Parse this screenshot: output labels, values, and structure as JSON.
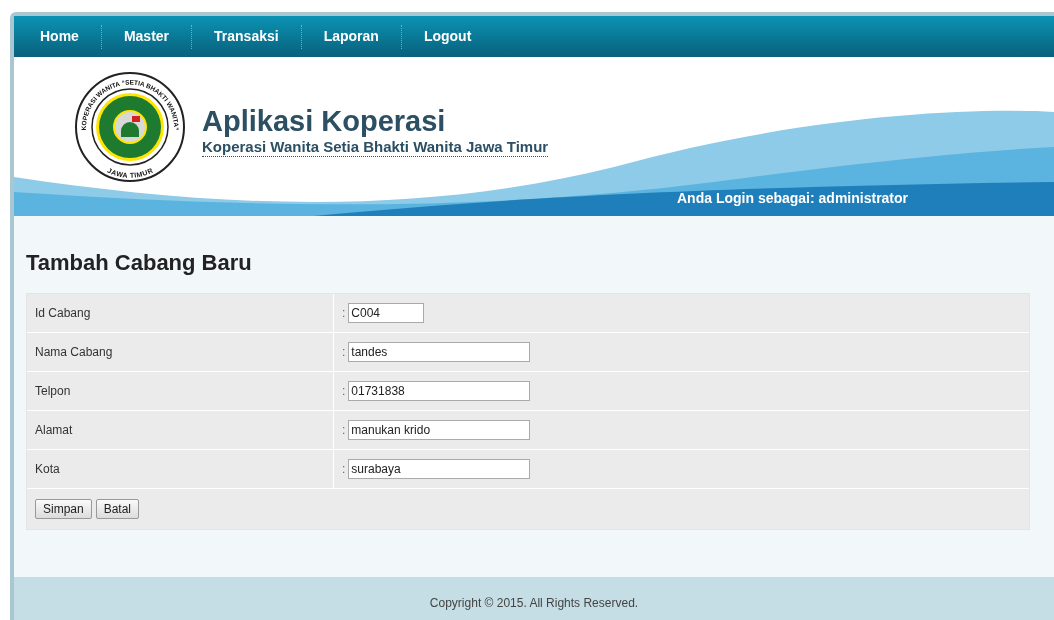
{
  "nav": [
    {
      "label": "Home"
    },
    {
      "label": "Master"
    },
    {
      "label": "Transaksi"
    },
    {
      "label": "Laporan"
    },
    {
      "label": "Logout"
    }
  ],
  "header": {
    "logo_text_top": "KOPERASI WANITA “SETIA BHAKTI WANITA”",
    "logo_text_bottom": "JAWA TIMUR",
    "title": "Aplikasi Koperasi",
    "subtitle": "Koperasi Wanita Setia Bhakti Wanita Jawa Timur",
    "login": "Anda Login sebagai: administrator"
  },
  "form": {
    "title": "Tambah Cabang Baru",
    "fields": [
      {
        "label": "Id Cabang",
        "separator": ":",
        "value": "C004",
        "kind": "short"
      },
      {
        "label": "Nama Cabang",
        "separator": ":",
        "value": "tandes",
        "kind": "long"
      },
      {
        "label": "Telpon",
        "separator": ":",
        "value": "01731838",
        "kind": "long"
      },
      {
        "label": "Alamat",
        "separator": ":",
        "value": "manukan krido",
        "kind": "long"
      },
      {
        "label": "Kota",
        "separator": ":",
        "value": "surabaya",
        "kind": "long"
      }
    ],
    "buttons": [
      "Simpan",
      "Batal"
    ]
  },
  "footer": "Copyright © 2015. All Rights Reserved."
}
